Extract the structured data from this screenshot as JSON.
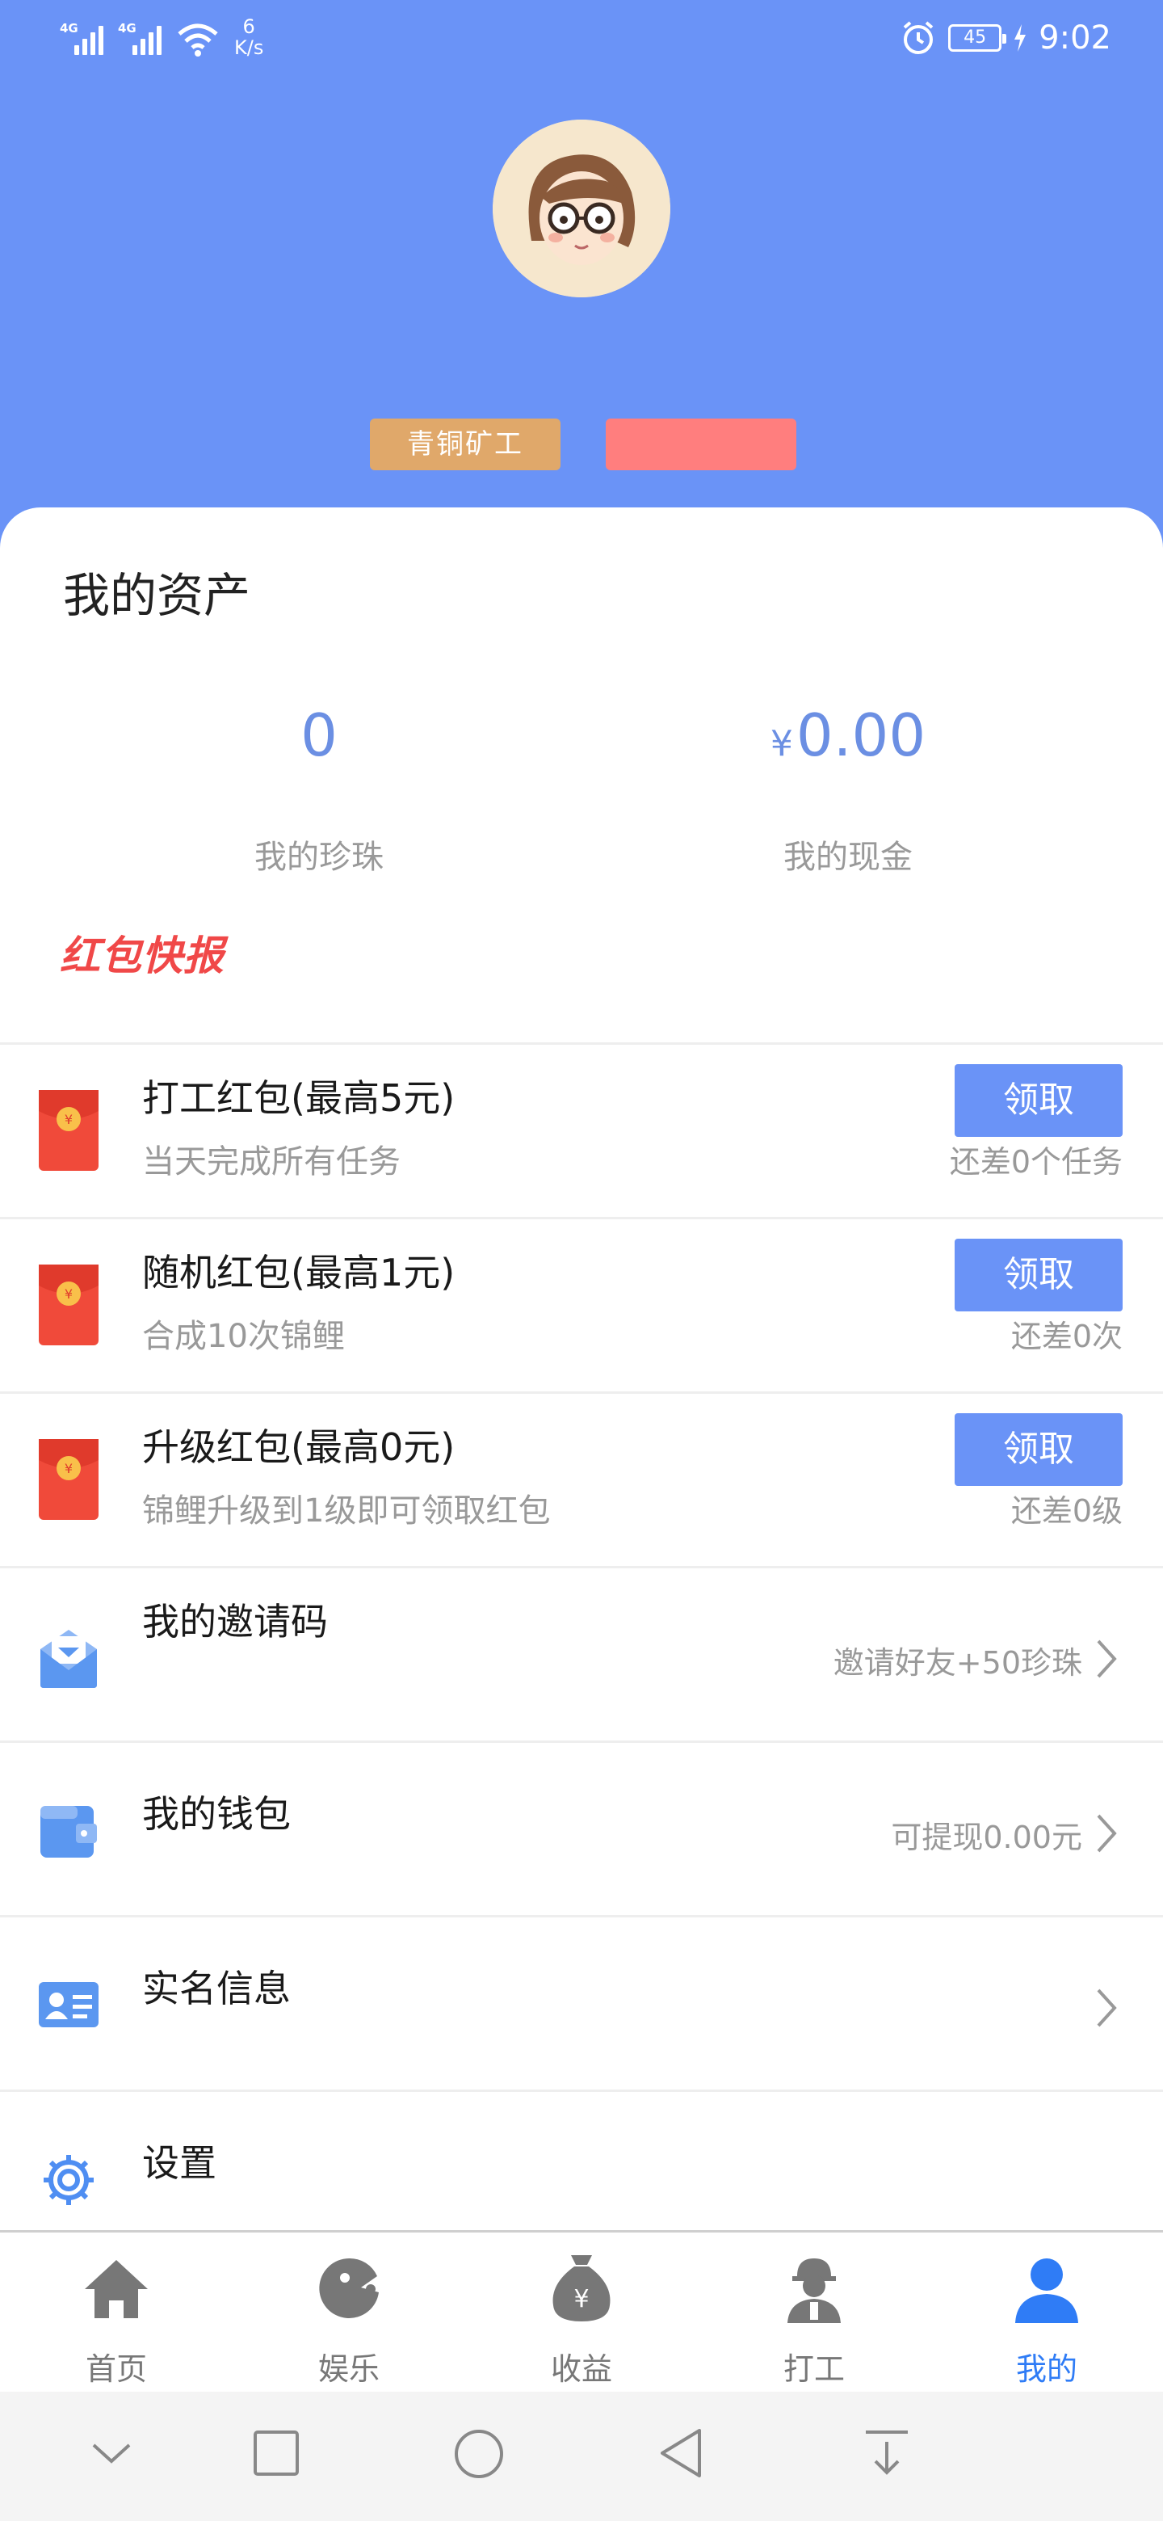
{
  "status_bar": {
    "network_1": "4G",
    "network_2": "4G",
    "speed_value": "6",
    "speed_unit": "K/s",
    "battery": "45",
    "time": "9:02"
  },
  "profile": {
    "rank_label": "青铜矿工"
  },
  "assets": {
    "title": "我的资产",
    "pearls_value": "0",
    "pearls_label": "我的珍珠",
    "cash_symbol": "¥",
    "cash_value": "0.00",
    "cash_label": "我的现金"
  },
  "news_banner": "红包快报",
  "red_packets": [
    {
      "title": "打工红包(最高5元)",
      "subtitle": "当天完成所有任务",
      "button": "领取",
      "remaining": "还差0个任务"
    },
    {
      "title": "随机红包(最高1元)",
      "subtitle": "合成10次锦鲤",
      "button": "领取",
      "remaining": "还差0次"
    },
    {
      "title": "升级红包(最高0元)",
      "subtitle": "锦鲤升级到1级即可领取红包",
      "button": "领取",
      "remaining": "还差0级"
    }
  ],
  "menu": {
    "invite": {
      "title": "我的邀请码",
      "hint": "邀请好友+50珍珠"
    },
    "wallet": {
      "title": "我的钱包",
      "hint": "可提现0.00元"
    },
    "realname": {
      "title": "实名信息"
    },
    "settings": {
      "title": "设置"
    }
  },
  "tabs": [
    {
      "label": "首页",
      "icon": "home-icon"
    },
    {
      "label": "娱乐",
      "icon": "game-icon"
    },
    {
      "label": "收益",
      "icon": "money-bag-icon"
    },
    {
      "label": "打工",
      "icon": "worker-icon"
    },
    {
      "label": "我的",
      "icon": "profile-icon",
      "active": true
    }
  ],
  "colors": {
    "header_blue": "#6a93f7",
    "accent_blue": "#2f7cf6",
    "rank_gold": "#e0a86a",
    "badge_pink": "#ff7e7e",
    "red_packet": "#f04848"
  }
}
